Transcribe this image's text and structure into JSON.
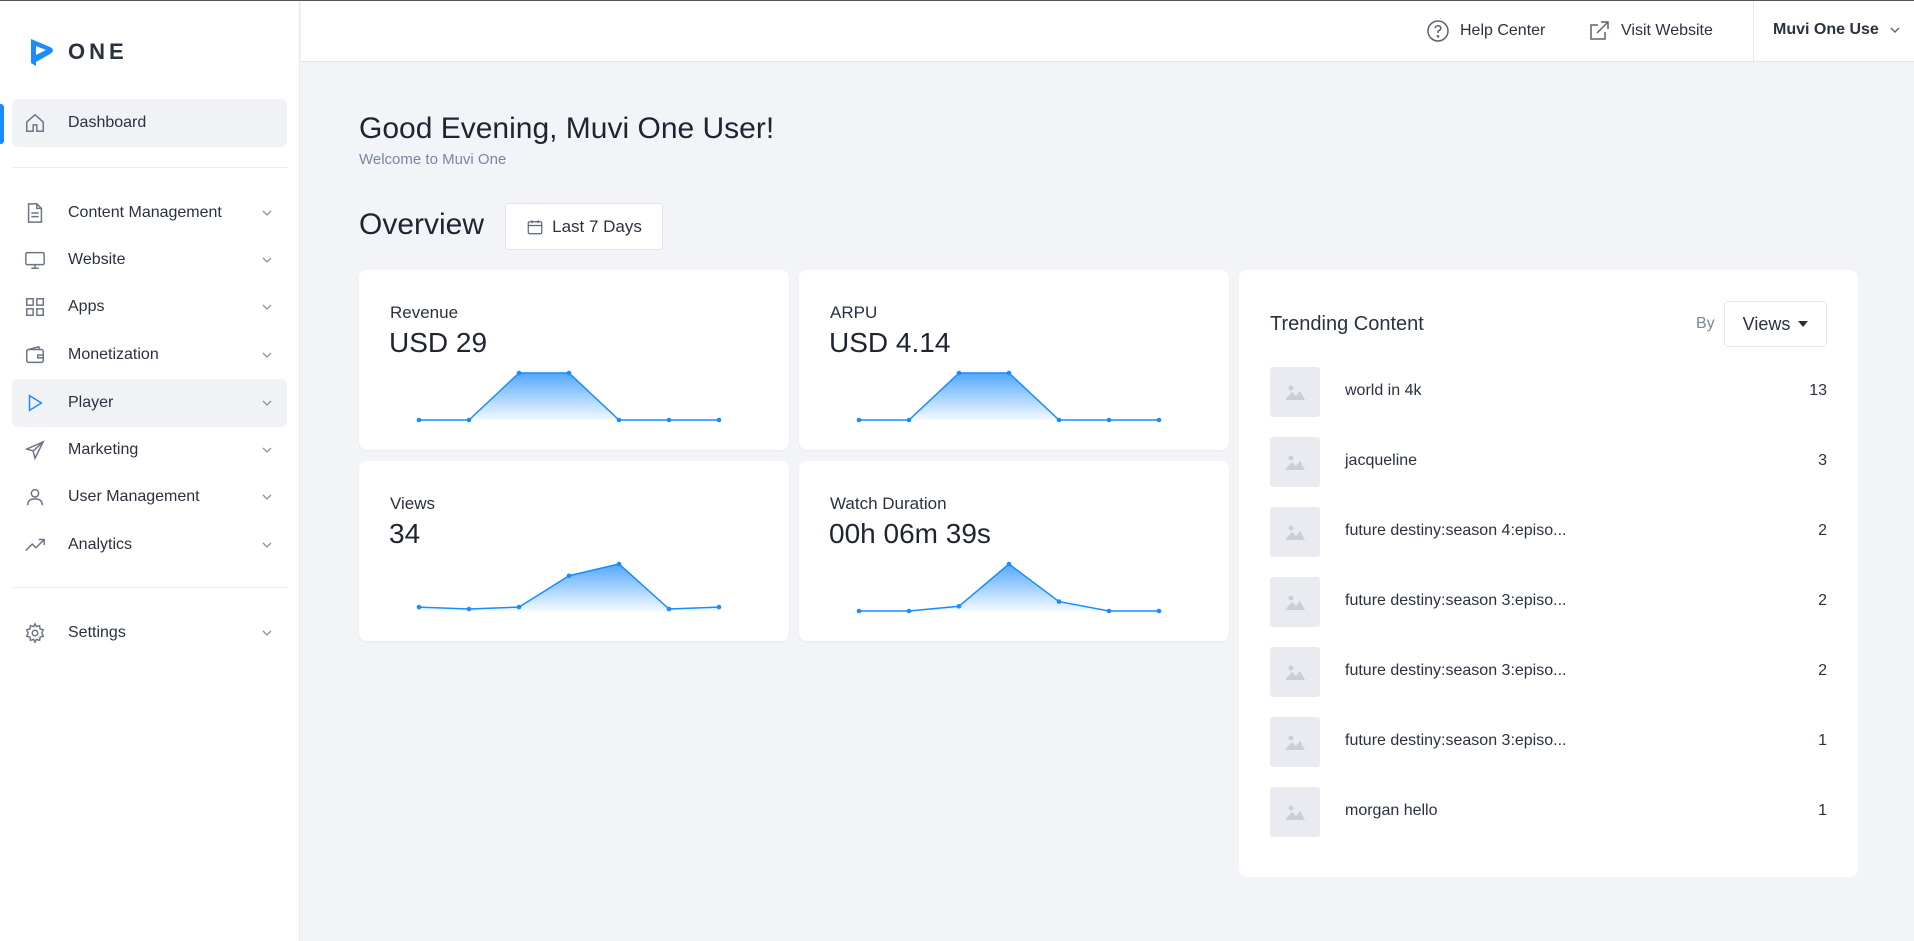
{
  "brand": {
    "logo_text": "ONE",
    "accent": "#1a8cff"
  },
  "sidebar": {
    "items": [
      {
        "label": "Dashboard",
        "icon": "home-icon",
        "active": true
      },
      {
        "label": "Content Management",
        "icon": "document-icon"
      },
      {
        "label": "Website",
        "icon": "monitor-icon"
      },
      {
        "label": "Apps",
        "icon": "grid-icon"
      },
      {
        "label": "Monetization",
        "icon": "wallet-icon"
      },
      {
        "label": "Player",
        "icon": "play-icon"
      },
      {
        "label": "Marketing",
        "icon": "send-icon"
      },
      {
        "label": "User Management",
        "icon": "user-icon"
      },
      {
        "label": "Analytics",
        "icon": "trending-up-icon"
      },
      {
        "label": "Settings",
        "icon": "gear-icon"
      }
    ]
  },
  "header": {
    "help_center": "Help Center",
    "visit_website": "Visit Website",
    "user_name": "Muvi One Use"
  },
  "main": {
    "greeting": "Good Evening, Muvi One User!",
    "welcome": "Welcome to Muvi One",
    "overview_title": "Overview",
    "date_range": "Last 7 Days"
  },
  "cards": [
    {
      "title": "Revenue",
      "value": "USD 29",
      "series": [
        0,
        0,
        1,
        1,
        0,
        0,
        0
      ]
    },
    {
      "title": "ARPU",
      "value": "USD 4.14",
      "series": [
        0,
        0,
        1,
        1,
        0,
        0,
        0
      ]
    },
    {
      "title": "Views",
      "value": "34",
      "series": [
        2,
        1,
        2,
        18,
        24,
        1,
        2
      ]
    },
    {
      "title": "Watch Duration",
      "value": "00h 06m 39s",
      "series": [
        0,
        0,
        0.1,
        1,
        0.2,
        0,
        0
      ]
    }
  ],
  "trending": {
    "title": "Trending Content",
    "by_label": "By",
    "sort_value": "Views",
    "items": [
      {
        "name": "world in 4k",
        "count": "13"
      },
      {
        "name": "jacqueline",
        "count": "3"
      },
      {
        "name": "future destiny:season 4:episo...",
        "count": "2"
      },
      {
        "name": "future destiny:season 3:episo...",
        "count": "2"
      },
      {
        "name": "future destiny:season 3:episo...",
        "count": "2"
      },
      {
        "name": "future destiny:season 3:episo...",
        "count": "1"
      },
      {
        "name": "morgan hello",
        "count": "1"
      }
    ]
  }
}
